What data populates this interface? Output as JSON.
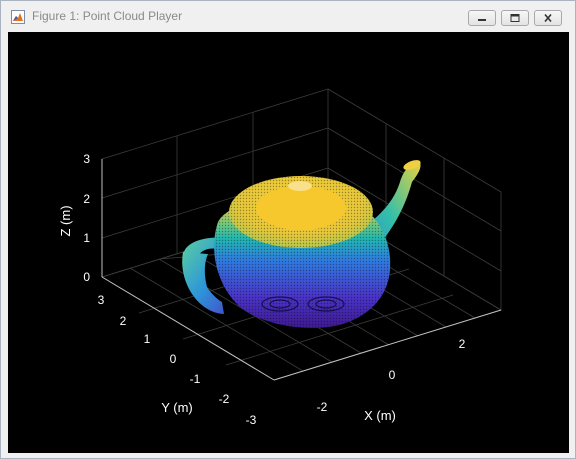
{
  "window": {
    "title": "Figure 1: Point Cloud Player",
    "icon": "matlab-figure-icon",
    "controls": [
      "minimize-icon",
      "maximize-icon",
      "close-icon"
    ]
  },
  "chart_data": {
    "type": "scatter3d",
    "subject": "teapot point cloud",
    "colormap": "parula",
    "color_by": "z",
    "background": "#000000",
    "grid": true,
    "xlabel": "X (m)",
    "ylabel": "Y (m)",
    "zlabel": "Z (m)",
    "xticks": [
      "-2",
      "0",
      "2"
    ],
    "yticks": [
      "3",
      "2",
      "1",
      "0",
      "-1",
      "-2",
      "-3"
    ],
    "zticks": [
      "3",
      "2",
      "1",
      "0"
    ],
    "xlim": [
      -3.5,
      3.5
    ],
    "ylim": [
      -3,
      3
    ],
    "zlim": [
      0,
      3
    ]
  }
}
